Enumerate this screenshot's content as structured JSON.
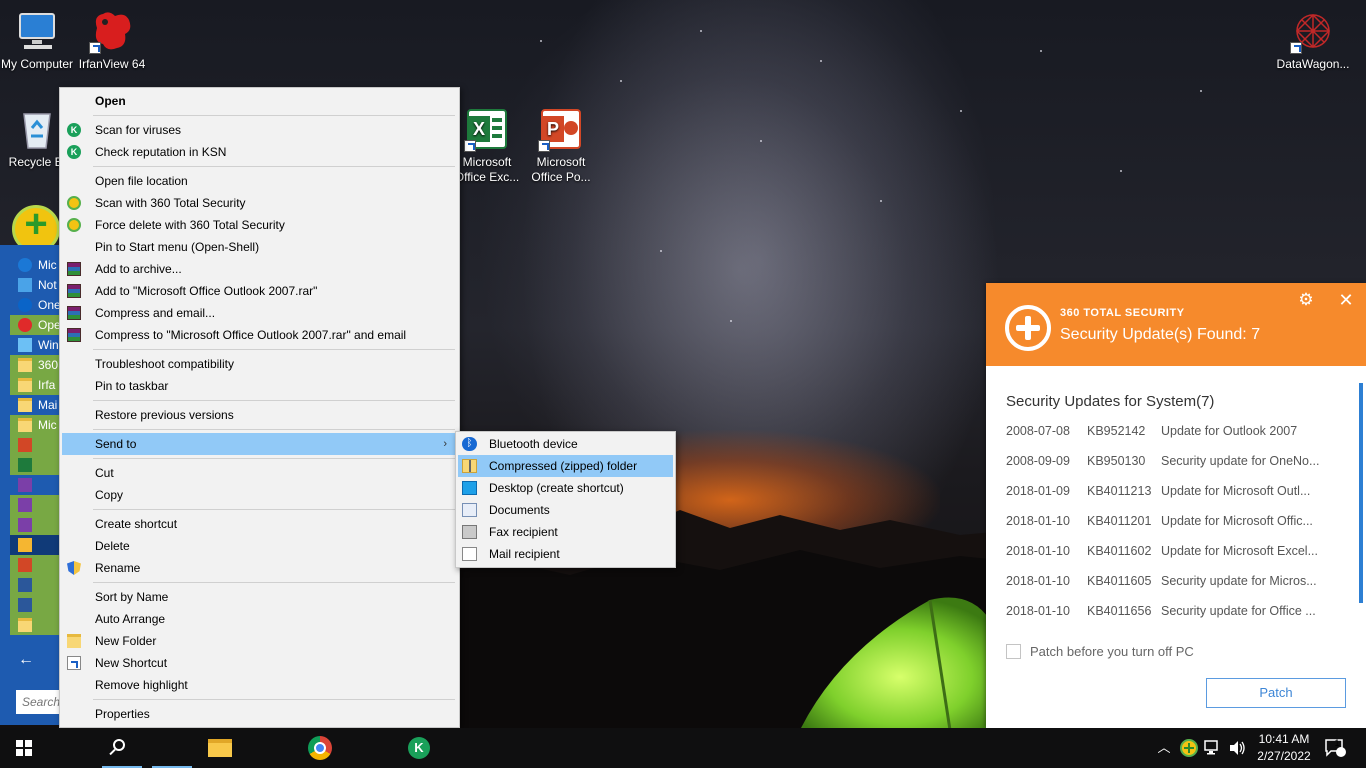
{
  "desktop": {
    "icons": {
      "my_computer": "My Computer",
      "irfanview": "IrfanView 64",
      "recycle_bin": "Recycle Bi",
      "excel": "Microsoft Office Exc...",
      "powerpoint": "Microsoft Office Po...",
      "datawagon": "DataWagon..."
    }
  },
  "start_menu": {
    "items": [
      "Mic",
      "Not",
      "One",
      "Ope",
      "Win",
      "360",
      "Irfa",
      "Mai",
      "Mic"
    ],
    "search_placeholder": "Search"
  },
  "context_menu": {
    "items": [
      {
        "label": "Open",
        "icon": "none"
      },
      {
        "label": "Scan for viruses",
        "icon": "kaspersky-icon"
      },
      {
        "label": "Check reputation in KSN",
        "icon": "kaspersky-icon"
      },
      {
        "label": "Open file location",
        "icon": "none"
      },
      {
        "label": "Scan with 360 Total Security",
        "icon": "360-icon"
      },
      {
        "label": "Force delete with 360 Total Security",
        "icon": "360-icon"
      },
      {
        "label": "Pin to Start menu (Open-Shell)",
        "icon": "none"
      },
      {
        "label": "Add to archive...",
        "icon": "winrar-icon"
      },
      {
        "label": "Add to \"Microsoft Office Outlook 2007.rar\"",
        "icon": "winrar-icon"
      },
      {
        "label": "Compress and email...",
        "icon": "winrar-icon"
      },
      {
        "label": "Compress to \"Microsoft Office Outlook 2007.rar\" and email",
        "icon": "winrar-icon"
      },
      {
        "label": "Troubleshoot compatibility",
        "icon": "none"
      },
      {
        "label": "Pin to taskbar",
        "icon": "none"
      },
      {
        "label": "Restore previous versions",
        "icon": "none"
      },
      {
        "label": "Send to",
        "icon": "none"
      },
      {
        "label": "Cut",
        "icon": "none"
      },
      {
        "label": "Copy",
        "icon": "none"
      },
      {
        "label": "Create shortcut",
        "icon": "none"
      },
      {
        "label": "Delete",
        "icon": "none"
      },
      {
        "label": "Rename",
        "icon": "uac-shield-icon"
      },
      {
        "label": "Sort by Name",
        "icon": "none"
      },
      {
        "label": "Auto Arrange",
        "icon": "none"
      },
      {
        "label": "New Folder",
        "icon": "folder-icon"
      },
      {
        "label": "New Shortcut",
        "icon": "shortcut-icon"
      },
      {
        "label": "Remove highlight",
        "icon": "none"
      },
      {
        "label": "Properties",
        "icon": "none"
      }
    ],
    "submenu_arrow": "›"
  },
  "send_to_menu": {
    "items": [
      {
        "label": "Bluetooth device",
        "icon": "bluetooth-icon"
      },
      {
        "label": "Compressed (zipped) folder",
        "icon": "zip-folder-icon"
      },
      {
        "label": "Desktop (create shortcut)",
        "icon": "desktop-icon"
      },
      {
        "label": "Documents",
        "icon": "documents-icon"
      },
      {
        "label": "Fax recipient",
        "icon": "fax-icon"
      },
      {
        "label": "Mail recipient",
        "icon": "mail-icon"
      }
    ]
  },
  "popup_360": {
    "brand": "360 TOTAL SECURITY",
    "title": "Security Update(s) Found: 7",
    "section_title": "Security Updates for System(7)",
    "updates": [
      {
        "date": "2008-07-08",
        "kb": "KB952142",
        "desc": "Update for Outlook 2007"
      },
      {
        "date": "2008-09-09",
        "kb": "KB950130",
        "desc": "Security update for OneNo..."
      },
      {
        "date": "2018-01-09",
        "kb": "KB4011213",
        "desc": "Update for Microsoft Outl..."
      },
      {
        "date": "2018-01-10",
        "kb": "KB4011201",
        "desc": "Update for Microsoft Offic..."
      },
      {
        "date": "2018-01-10",
        "kb": "KB4011602",
        "desc": "Update for Microsoft Excel..."
      },
      {
        "date": "2018-01-10",
        "kb": "KB4011605",
        "desc": "Security update for Micros..."
      },
      {
        "date": "2018-01-10",
        "kb": "KB4011656",
        "desc": "Security update for Office ..."
      }
    ],
    "checkbox_label": "Patch before you turn off PC",
    "patch_button": "Patch",
    "accent_color": "#f68a2c"
  },
  "taskbar": {
    "clock_time": "10:41 AM",
    "clock_date": "2/27/2022",
    "notification_count": "1"
  }
}
